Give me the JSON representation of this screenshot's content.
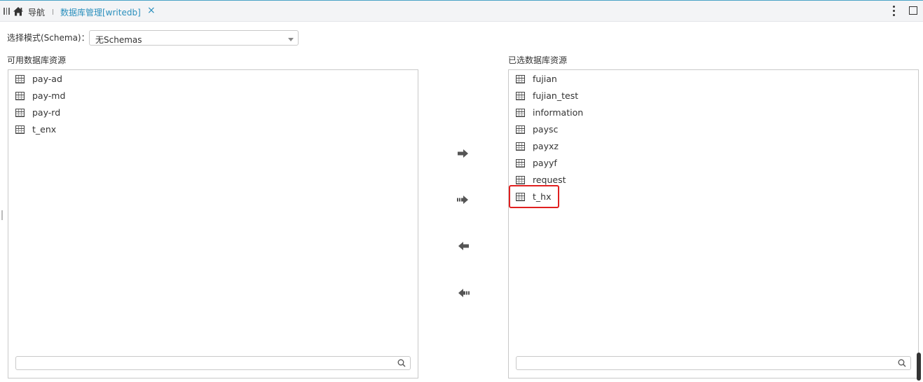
{
  "tabs": {
    "nav_label": "导航",
    "active_label": "数据库管理[writedb]",
    "close_glyph": "×"
  },
  "schema": {
    "label": "选择模式(Schema)：",
    "value": "无Schemas"
  },
  "available": {
    "title": "可用数据库资源",
    "items": [
      "pay-ad",
      "pay-md",
      "pay-rd",
      "t_enx"
    ]
  },
  "selected": {
    "title": "已选数据库资源",
    "items": [
      "fujian",
      "fujian_test",
      "information",
      "paysc",
      "payxz",
      "payyf",
      "request",
      "t_hx"
    ],
    "highlighted_item": "t_hx"
  },
  "icons": {
    "home": "home-icon",
    "table": "table-icon",
    "search": "search-icon",
    "move_right": "arrow-right-icon",
    "move_all_right": "double-arrow-right-icon",
    "move_left": "arrow-left-icon",
    "move_all_left": "double-arrow-left-icon"
  },
  "colors": {
    "accent": "#2a8fbd",
    "highlight": "#e02020"
  }
}
